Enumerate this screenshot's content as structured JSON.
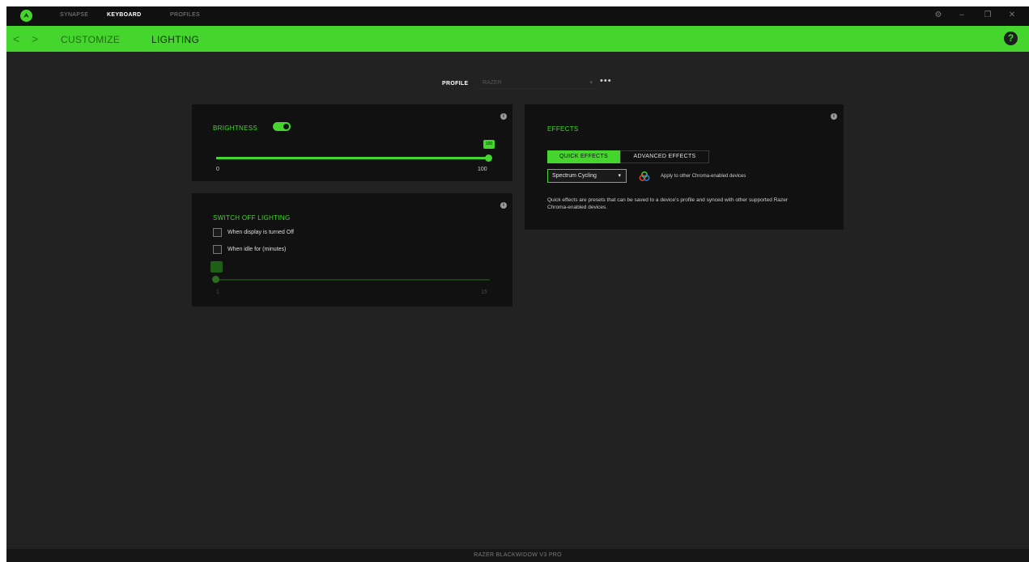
{
  "titlebar": {
    "nav": [
      "SYNAPSE",
      "KEYBOARD",
      "PROFILES"
    ],
    "active_nav": "KEYBOARD",
    "window_controls": [
      "gear-icon",
      "minimize-icon",
      "restore-icon",
      "close-icon"
    ]
  },
  "header": {
    "tabs": [
      "CUSTOMIZE",
      "LIGHTING"
    ],
    "active_tab": "LIGHTING",
    "help": "?"
  },
  "profile": {
    "label": "PROFILE",
    "value": "RAZER",
    "more": "•••"
  },
  "brightness": {
    "title": "BRIGHTNESS",
    "enabled": true,
    "value": "100",
    "level": 100,
    "min": "0",
    "max": "100"
  },
  "switch_off": {
    "title": "SWITCH OFF LIGHTING",
    "options": [
      {
        "label": "When display is turned Off",
        "checked": false
      },
      {
        "label": "When idle for (minutes)",
        "checked": false
      }
    ],
    "idle_value": "1",
    "idle_min": "1",
    "idle_max": "15"
  },
  "effects": {
    "title": "EFFECTS",
    "tabs": [
      "QUICK EFFECTS",
      "ADVANCED EFFECTS"
    ],
    "active_tab": "QUICK EFFECTS",
    "selected_effect": "Spectrum Cycling",
    "apply_text": "Apply to other Chroma-enabled devices",
    "description": "Quick effects are presets that can be saved to a device's profile and synced with other supported Razer Chroma-enabled devices."
  },
  "status": {
    "device_name": "RAZER BLACKWIDOW V3 PRO"
  },
  "colors": {
    "accent": "#44d62c",
    "background": "#222222",
    "panel": "#111111",
    "titlebar": "#101010"
  }
}
